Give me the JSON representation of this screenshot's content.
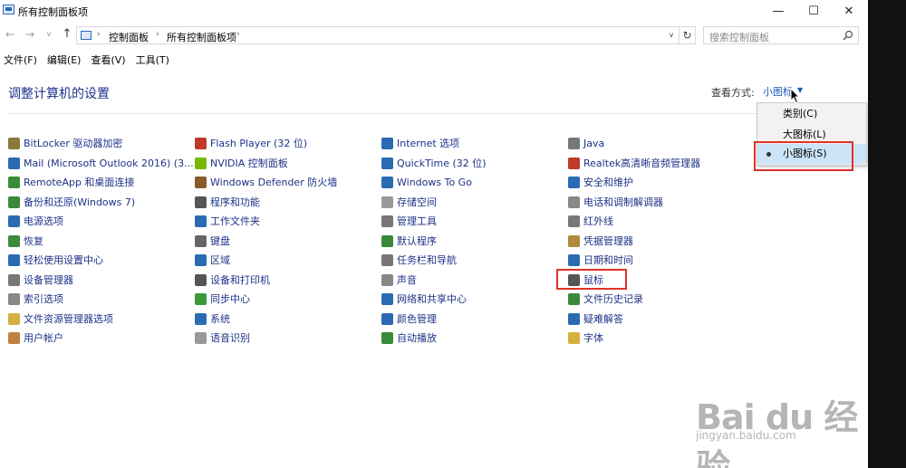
{
  "window": {
    "title": "所有控制面板项",
    "minimize": "—",
    "maximize": "☐",
    "close": "✕"
  },
  "address": {
    "back": "←",
    "forward": "→",
    "dropdown": "v",
    "up": "↑",
    "crumbs": [
      "控制面板",
      "所有控制面板项"
    ],
    "sep": "›",
    "refresh": "↻",
    "search_placeholder": "搜索控制面板"
  },
  "menu": [
    "文件(F)",
    "编辑(E)",
    "查看(V)",
    "工具(T)"
  ],
  "header": {
    "title": "调整计算机的设置",
    "view_by_label": "查看方式:",
    "view_by_value": "小图标",
    "view_by_arrow": "▼"
  },
  "view_menu": {
    "options": [
      "类别(C)",
      "大图标(L)",
      "小图标(S)"
    ],
    "selected": "小图标(S)"
  },
  "items": {
    "col1": [
      "BitLocker 驱动器加密",
      "Mail (Microsoft Outlook 2016) (3...",
      "RemoteApp 和桌面连接",
      "备份和还原(Windows 7)",
      "电源选项",
      "恢复",
      "轻松使用设置中心",
      "设备管理器",
      "索引选项",
      "文件资源管理器选项",
      "用户帐户"
    ],
    "col2": [
      "Flash Player (32 位)",
      "NVIDIA 控制面板",
      "Windows Defender 防火墙",
      "程序和功能",
      "工作文件夹",
      "键盘",
      "区域",
      "设备和打印机",
      "同步中心",
      "系统",
      "语音识别"
    ],
    "col3": [
      "Internet 选项",
      "QuickTime (32 位)",
      "Windows To Go",
      "存储空间",
      "管理工具",
      "默认程序",
      "任务栏和导航",
      "声音",
      "网络和共享中心",
      "颜色管理",
      "自动播放"
    ],
    "col4": [
      "Java",
      "Realtek高清晰音频管理器",
      "安全和维护",
      "电话和调制解调器",
      "红外线",
      "凭据管理器",
      "日期和时间",
      "鼠标",
      "文件历史记录",
      "疑难解答",
      "字体"
    ]
  },
  "colors": {
    "link": "#1e3287",
    "title": "#1e3287",
    "highlight": "#e0322a",
    "selected_bg": "#cce4f7"
  },
  "watermark": {
    "main": "Bai du 经验",
    "sub": "jingyan.baidu.com"
  }
}
